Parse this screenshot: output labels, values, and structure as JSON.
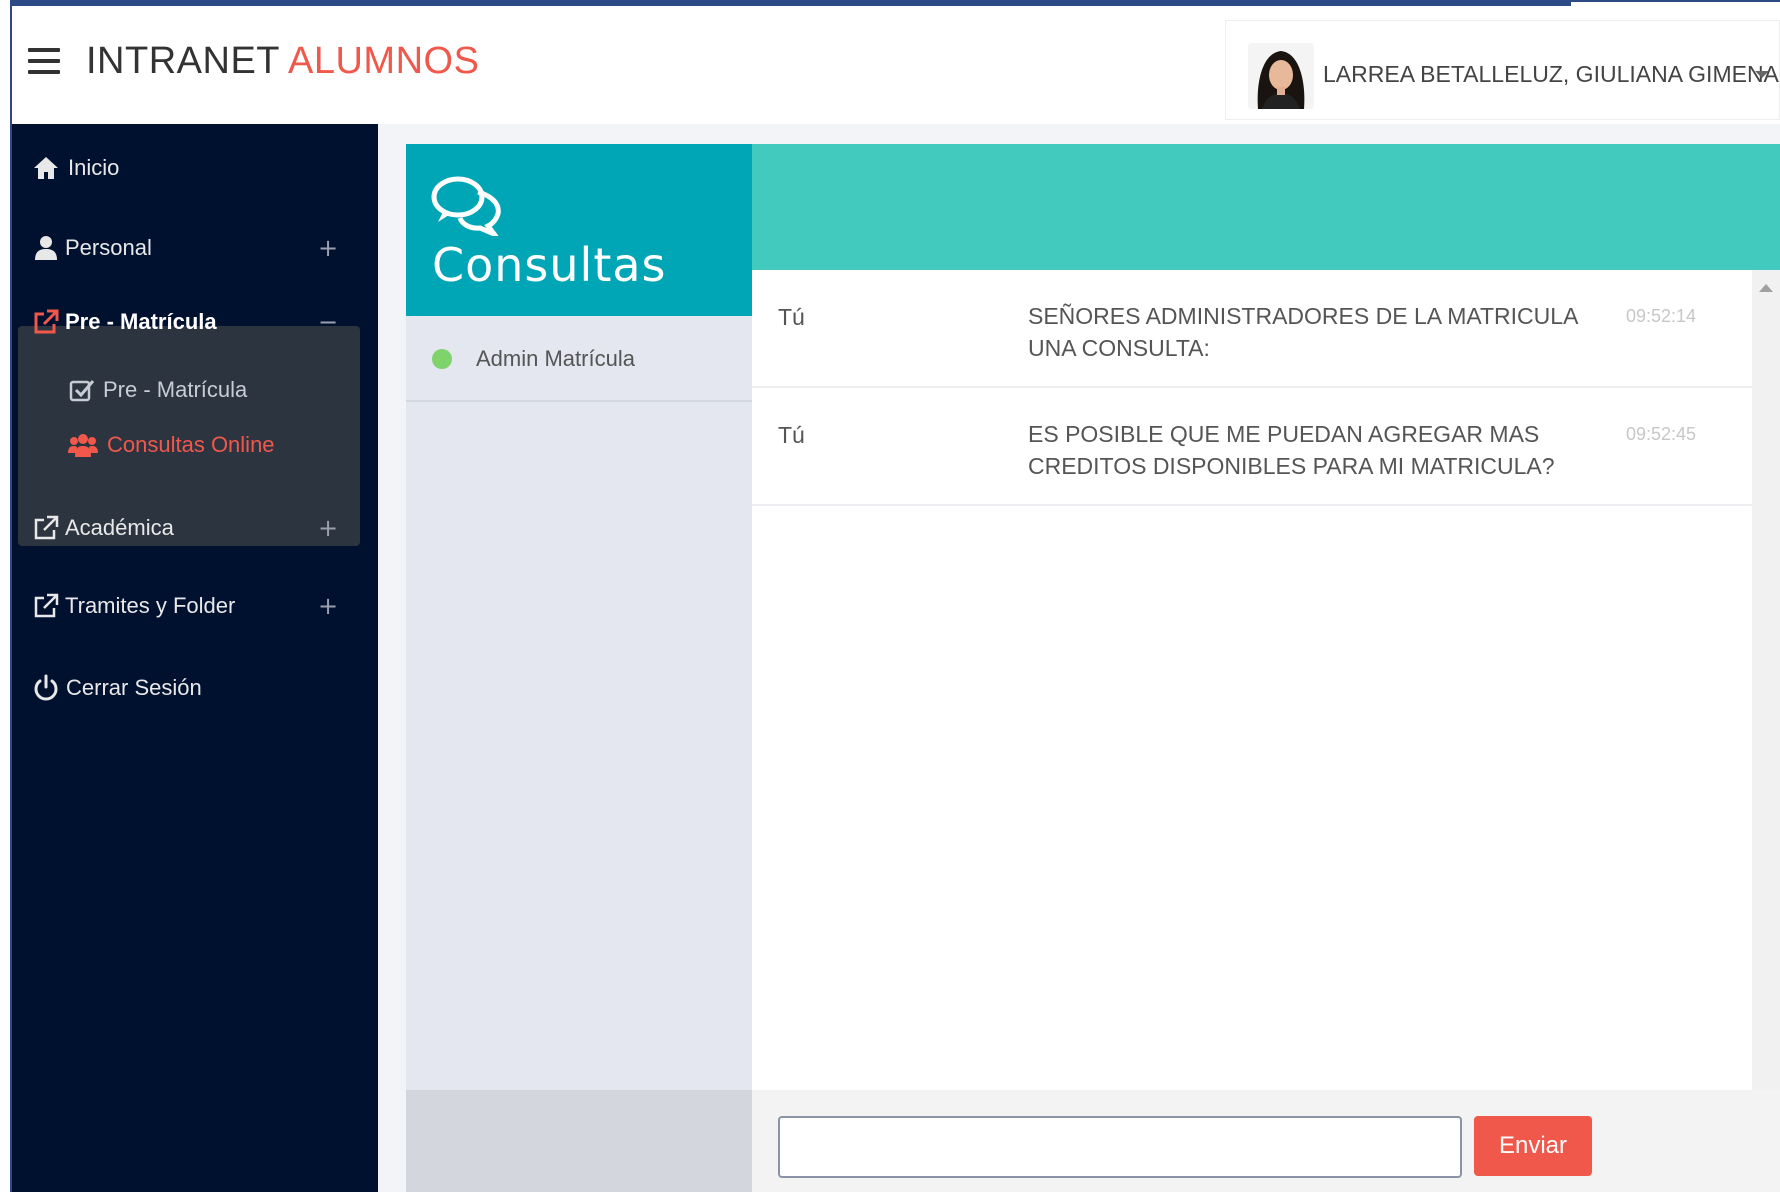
{
  "header": {
    "brand_part1": "INTRANET",
    "brand_part2": "ALUMNOS",
    "user_name": "LARREA BETALLELUZ, GIULIANA GIMENA"
  },
  "sidebar": {
    "items": [
      {
        "label": "Inicio",
        "icon": "home-icon"
      },
      {
        "label": "Personal",
        "icon": "user-icon",
        "toggle": "+"
      },
      {
        "label": "Pre - Matrícula",
        "icon": "external-link-icon",
        "toggle": "−"
      },
      {
        "label": "Pre - Matrícula",
        "icon": "checkbox-icon"
      },
      {
        "label": "Consultas Online",
        "icon": "users-icon"
      },
      {
        "label": "Académica",
        "icon": "external-link-icon",
        "toggle": "+"
      },
      {
        "label": "Tramites y Folder",
        "icon": "external-link-icon",
        "toggle": "+"
      },
      {
        "label": "Cerrar Sesión",
        "icon": "power-icon"
      }
    ]
  },
  "contacts": {
    "title": "Consultas",
    "list": [
      {
        "name": "Admin Matrícula",
        "status": "online"
      }
    ]
  },
  "chat": {
    "messages": [
      {
        "who": "Tú",
        "text": "SEÑORES ADMINISTRADORES DE LA MATRICULA UNA CONSULTA:",
        "time": "09:52:14"
      },
      {
        "who": "Tú",
        "text": "ES POSIBLE QUE ME PUEDAN AGREGAR MAS CREDITOS DISPONIBLES PARA MI MATRICULA?",
        "time": "09:52:45"
      }
    ],
    "input_value": "",
    "send_label": "Enviar"
  },
  "colors": {
    "accent": "#f0584b",
    "sidebar_bg": "#00112f",
    "teal_dark": "#00a6b5",
    "teal_light": "#43cabf",
    "online": "#7ed36b"
  }
}
